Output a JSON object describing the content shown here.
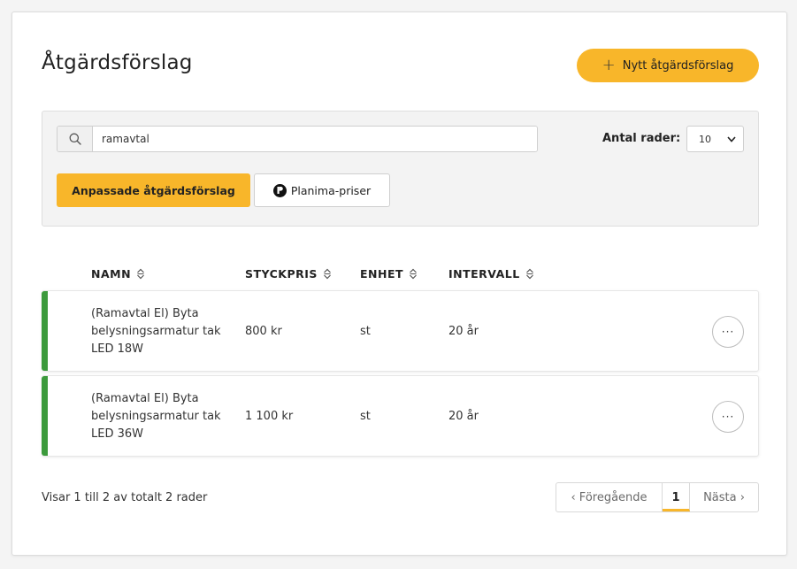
{
  "header": {
    "title": "Åtgärdsförslag",
    "new_button_label": "Nytt åtgärdsförslag",
    "new_button_icon": "plus-icon"
  },
  "filters": {
    "search_value": "ramavtal",
    "search_icon": "search-icon",
    "rows_label": "Antal rader:",
    "rows_selected": "10",
    "custom_button_label": "Anpassade åtgärdsförslag",
    "planima_button_label": "Planima-priser"
  },
  "table": {
    "columns": [
      "NAMN",
      "STYCKPRIS",
      "ENHET",
      "INTERVALL"
    ],
    "rows": [
      {
        "name": "(Ramavtal El) Byta belysningsarmatur tak LED 18W",
        "price": "800 kr",
        "unit": "st",
        "interval": "20 år",
        "more": "···"
      },
      {
        "name": "(Ramavtal El) Byta belysningsarmatur tak LED 36W",
        "price": "1 100 kr",
        "unit": "st",
        "interval": "20 år",
        "more": "···"
      }
    ]
  },
  "footer": {
    "summary": "Visar 1 till 2 av totalt 2 rader",
    "prev_label": "‹ Föregående",
    "current_page": "1",
    "next_label": "Nästa ›"
  },
  "colors": {
    "accent_yellow": "#f8b62a",
    "row_accent_green": "#3c9a3c"
  }
}
